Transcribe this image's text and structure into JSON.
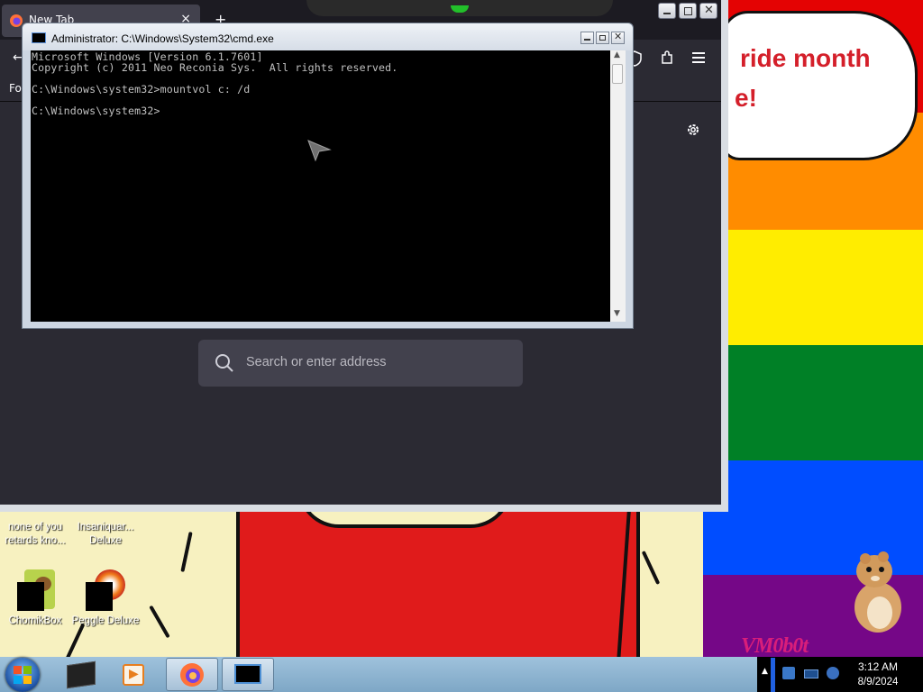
{
  "wallpaper": {
    "rainbow_colors": [
      "#e40303",
      "#ff8c00",
      "#ffed00",
      "#008026",
      "#004dff",
      "#750787"
    ],
    "speech_line1": "ride month",
    "speech_line2": "e!",
    "logo_text": "VM0b0t"
  },
  "desktop_icons": [
    {
      "label_line1": "none of you",
      "label_line2": "retards kno..."
    },
    {
      "label_line1": "Insaniquar...",
      "label_line2": "Deluxe"
    },
    {
      "label_line1": "ChomikBox",
      "label_line2": ""
    },
    {
      "label_line1": "Peggle Deluxe",
      "label_line2": ""
    }
  ],
  "firefox": {
    "tab_title": "New Tab",
    "tab_close": "×",
    "new_tab": "+",
    "bookmarks_label": "Fo",
    "search_placeholder": "Search or enter address"
  },
  "cmd": {
    "title": "Administrator: C:\\Windows\\System32\\cmd.exe",
    "lines": [
      "Microsoft Windows [Version 6.1.7601]",
      "Copyright (c) 2011 Neo Reconia Sys.  All rights reserved.",
      "",
      "C:\\Windows\\system32>mountvol c: /d",
      "",
      "C:\\Windows\\system32>"
    ]
  },
  "taskbar": {
    "time": "3:12 AM",
    "date": "8/9/2024",
    "apps": [
      "start-orb",
      "terminal-app",
      "media-player",
      "firefox",
      "cmd"
    ]
  }
}
